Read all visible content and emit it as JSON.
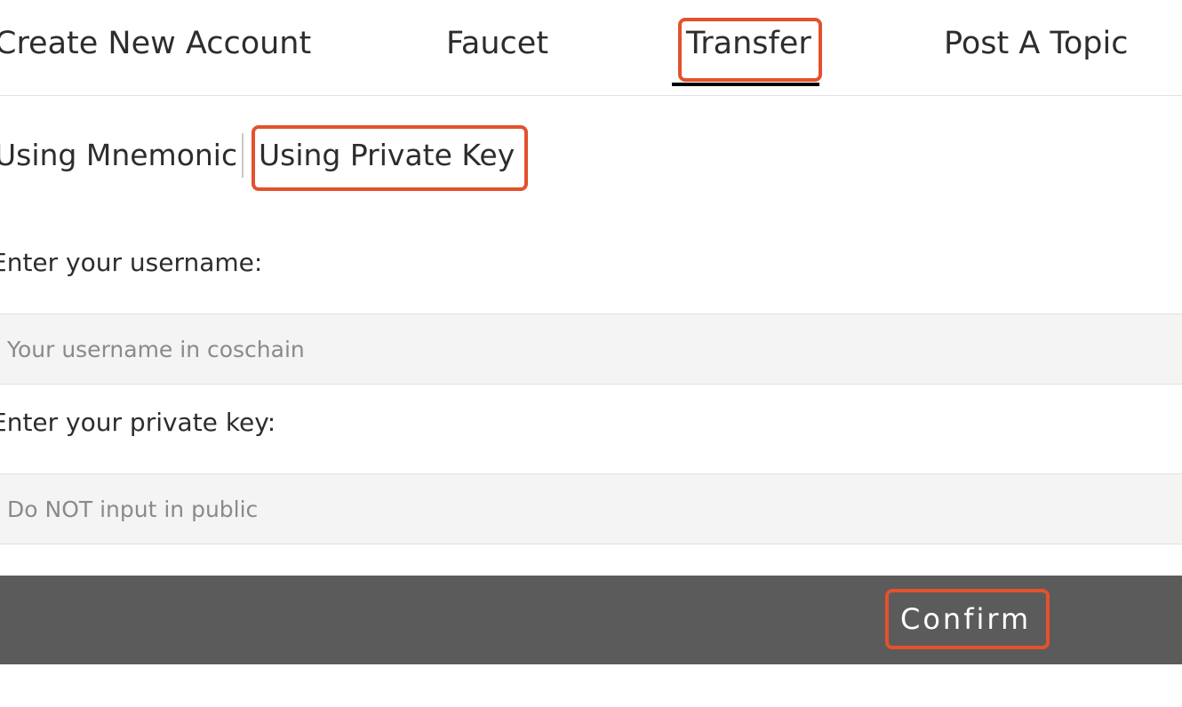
{
  "tabs": {
    "create_account": "Create New Account",
    "faucet": "Faucet",
    "transfer": "Transfer",
    "post_topic": "Post A Topic",
    "active": "Transfer"
  },
  "login_method": {
    "mnemonic": "Using Mnemonic",
    "private_key": "Using Private Key",
    "selected": "Using Private Key"
  },
  "form": {
    "username_label": "Enter your username:",
    "username_placeholder": "Your username in coschain",
    "username_value": "",
    "private_key_label": "Enter your private key:",
    "private_key_placeholder": "Do NOT input in public",
    "private_key_value": ""
  },
  "actions": {
    "confirm_label": "Confirm"
  },
  "colors": {
    "highlight": "#e4512d",
    "confirm_bar": "#5b5b5b",
    "input_background": "#f4f4f4"
  }
}
